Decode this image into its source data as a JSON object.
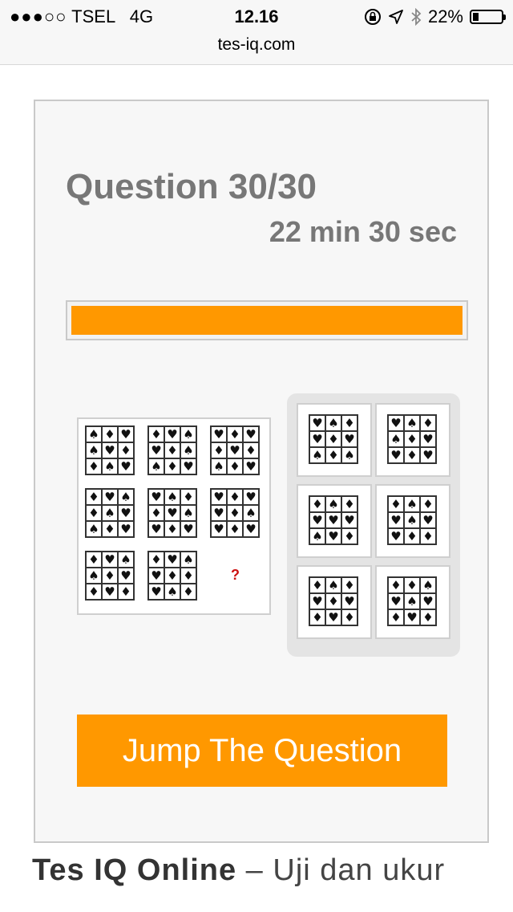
{
  "status_bar": {
    "carrier_dots": "●●●○○",
    "carrier": "TSEL",
    "network": "4G",
    "time": "12.16",
    "battery": "22%",
    "battery_level": 0.22,
    "icons": [
      "rotation-lock-icon",
      "location-arrow-icon",
      "bluetooth-icon",
      "battery-icon"
    ]
  },
  "browser": {
    "url": "tes-iq.com"
  },
  "quiz": {
    "title": "Question 30/30",
    "timer": "22 min 30 sec",
    "progress": 1.0,
    "accent_color": "#ff9800",
    "puzzle": {
      "missing_mark": "?",
      "cells": [
        [
          "♠♦♥",
          "♠♥♦",
          "♦♠♥"
        ],
        [
          "♦♥♠",
          "♥♦♠",
          "♠♦♥"
        ],
        [
          "♥♦♥",
          "♦♥♦",
          "♠♦♥"
        ],
        [
          "♦♥♠",
          "♦♠♥",
          "♠♦♥"
        ],
        [
          "♥♠♦",
          "♦♥♠",
          "♥♦♥"
        ],
        [
          "♥♦♥",
          "♥♦♠",
          "♥♦♥"
        ],
        [
          "♦♥♠",
          "♠♦♥",
          "♦♥♦"
        ],
        [
          "♦♥♠",
          "♥♦♦",
          "♥♠♦"
        ]
      ],
      "options": [
        [
          "♥♠♦",
          "♥♦♥",
          "♠♦♠"
        ],
        [
          "♥♠♦",
          "♠♦♥",
          "♥♦♥"
        ],
        [
          "♦♠♦",
          "♥♥♥",
          "♠♥♦"
        ],
        [
          "♦♠♦",
          "♥♠♥",
          "♥♦♦"
        ],
        [
          "♦♠♦",
          "♥♦♥",
          "♦♥♦"
        ],
        [
          "♦♦♠",
          "♥♠♥",
          "♦♥♦"
        ]
      ]
    },
    "jump_button": "Jump The Question"
  },
  "article": {
    "lead_bold": "Tes IQ Online",
    "lead_rest": " – Uji dan ukur"
  }
}
